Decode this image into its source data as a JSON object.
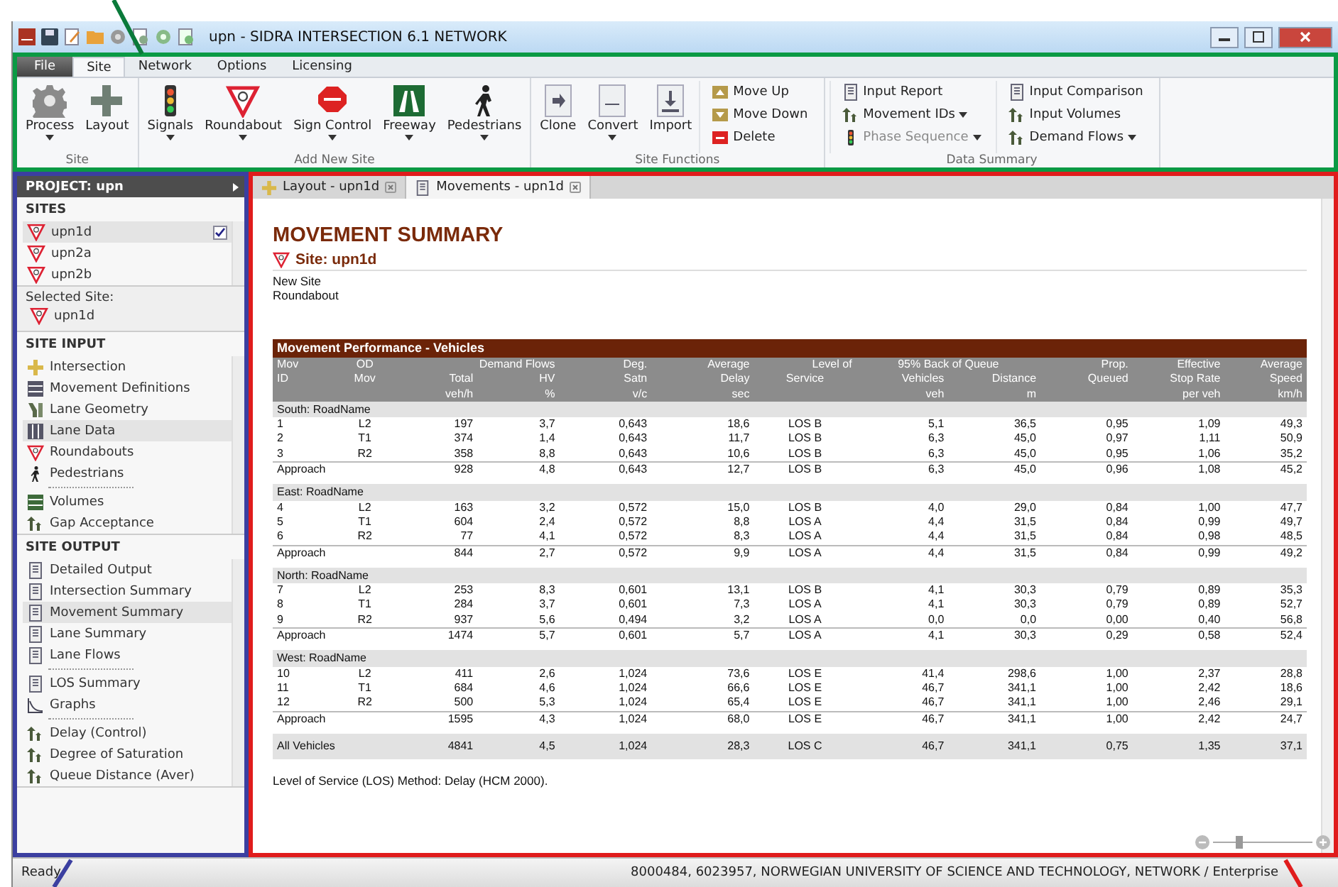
{
  "window": {
    "title": "upn - SIDRA INTERSECTION 6.1 NETWORK"
  },
  "ribbon": {
    "tabs": [
      {
        "label": "File",
        "selected": false,
        "kind": "file"
      },
      {
        "label": "Site",
        "selected": true,
        "kind": "tab"
      },
      {
        "label": "Network",
        "selected": false,
        "kind": "tab"
      },
      {
        "label": "Options",
        "selected": false,
        "kind": "tab"
      },
      {
        "label": "Licensing",
        "selected": false,
        "kind": "tab"
      }
    ],
    "groups": [
      {
        "label": "Site",
        "large": [
          {
            "label": "Process",
            "dropdown": true
          },
          {
            "label": "Layout",
            "dropdown": false
          }
        ]
      },
      {
        "label": "Add New Site",
        "large": [
          {
            "label": "Signals",
            "dropdown": true
          },
          {
            "label": "Roundabout",
            "dropdown": true
          },
          {
            "label": "Sign Control",
            "dropdown": true
          },
          {
            "label": "Freeway",
            "dropdown": true
          },
          {
            "label": "Pedestrians",
            "dropdown": true
          }
        ]
      },
      {
        "label": "Site Functions",
        "large": [
          {
            "label": "Clone",
            "dropdown": false
          },
          {
            "label": "Convert",
            "dropdown": true
          },
          {
            "label": "Import",
            "dropdown": false
          }
        ],
        "small": [
          [
            {
              "label": "Move Up",
              "dropdown": false,
              "disabled": false
            },
            {
              "label": "Move Down",
              "dropdown": false,
              "disabled": false
            },
            {
              "label": "Delete",
              "dropdown": false,
              "disabled": false
            }
          ]
        ]
      },
      {
        "label": "Data Summary",
        "small": [
          [
            {
              "label": "Input Report",
              "dropdown": false,
              "disabled": false
            },
            {
              "label": "Movement IDs",
              "dropdown": true,
              "disabled": false
            },
            {
              "label": "Phase Sequence",
              "dropdown": true,
              "disabled": true
            }
          ],
          [
            {
              "label": "Input Comparison",
              "dropdown": false,
              "disabled": false
            },
            {
              "label": "Input Volumes",
              "dropdown": false,
              "disabled": false
            },
            {
              "label": "Demand Flows",
              "dropdown": true,
              "disabled": false
            }
          ]
        ]
      }
    ]
  },
  "sidebar": {
    "project": "PROJECT:  upn",
    "sites": {
      "title": "SITES",
      "items": [
        {
          "name": "upn1d",
          "selected": true,
          "checked": true
        },
        {
          "name": "upn2a",
          "selected": false,
          "checked": false
        },
        {
          "name": "upn2b",
          "selected": false,
          "checked": false
        }
      ]
    },
    "selected_site": {
      "label": "Selected Site:",
      "name": "upn1d"
    },
    "input": {
      "title": "SITE INPUT",
      "groups": [
        [
          {
            "label": "Intersection",
            "selected": false
          },
          {
            "label": "Movement Definitions",
            "selected": false
          },
          {
            "label": "Lane Geometry",
            "selected": false
          },
          {
            "label": "Lane Data",
            "selected": true
          },
          {
            "label": "Roundabouts",
            "selected": false
          },
          {
            "label": "Pedestrians",
            "selected": false
          }
        ],
        [
          {
            "label": "Volumes",
            "selected": false
          },
          {
            "label": "Gap Acceptance",
            "selected": false
          }
        ]
      ]
    },
    "output": {
      "title": "SITE OUTPUT",
      "groups": [
        [
          {
            "label": "Detailed Output",
            "selected": false
          },
          {
            "label": "Intersection Summary",
            "selected": false
          },
          {
            "label": "Movement Summary",
            "selected": true
          },
          {
            "label": "Lane Summary",
            "selected": false
          },
          {
            "label": "Lane Flows",
            "selected": false
          }
        ],
        [
          {
            "label": "LOS Summary",
            "selected": false
          },
          {
            "label": "Graphs",
            "selected": false
          }
        ],
        [
          {
            "label": "Delay (Control)",
            "selected": false
          },
          {
            "label": "Degree of Saturation",
            "selected": false
          },
          {
            "label": "Queue Distance (Aver)",
            "selected": false
          }
        ]
      ]
    }
  },
  "document_tabs": [
    {
      "label": "Layout - upn1d",
      "selected": false
    },
    {
      "label": "Movements - upn1d",
      "selected": true
    }
  ],
  "report": {
    "title": "MOVEMENT SUMMARY",
    "site": "Site: upn1d",
    "lines": [
      "New Site",
      "Roundabout"
    ],
    "table": {
      "caption": "Movement Performance - Vehicles",
      "header_rows": [
        [
          {
            "text": "Mov"
          },
          {
            "text": "OD"
          },
          {
            "text": "Demand Flows",
            "kind": "group"
          },
          {
            "text": "Deg."
          },
          {
            "text": "Average"
          },
          {
            "text": "Level of"
          },
          {
            "text": "95% Back of Queue",
            "kind": "group"
          },
          {
            "text": "Prop."
          },
          {
            "text": "Effective"
          },
          {
            "text": "Average"
          }
        ],
        [
          {
            "text": "ID"
          },
          {
            "text": "Mov"
          },
          {
            "text": "Total"
          },
          {
            "text": "HV"
          },
          {
            "text": "Satn"
          },
          {
            "text": "Delay"
          },
          {
            "text": "Service"
          },
          {
            "text": "Vehicles"
          },
          {
            "text": "Distance"
          },
          {
            "text": "Queued"
          },
          {
            "text": "Stop Rate"
          },
          {
            "text": "Speed"
          }
        ],
        [
          null,
          null,
          {
            "text": "veh/h"
          },
          {
            "text": "%"
          },
          {
            "text": "v/c"
          },
          {
            "text": "sec"
          },
          null,
          {
            "text": "veh"
          },
          {
            "text": "m"
          },
          null,
          {
            "text": "per veh"
          },
          {
            "text": "km/h"
          }
        ]
      ],
      "sections": [
        {
          "title": "South: RoadName",
          "rows": [
            [
              "1",
              "L2",
              "197",
              "3,7",
              "0,643",
              "18,6",
              "LOS B",
              "5,1",
              "36,5",
              "0,95",
              "1,09",
              "49,3"
            ],
            [
              "2",
              "T1",
              "374",
              "1,4",
              "0,643",
              "11,7",
              "LOS B",
              "6,3",
              "45,0",
              "0,97",
              "1,11",
              "50,9"
            ],
            [
              "3",
              "R2",
              "358",
              "8,8",
              "0,643",
              "10,6",
              "LOS B",
              "6,3",
              "45,0",
              "0,95",
              "1,06",
              "35,2"
            ]
          ],
          "approach": {
            "label": "Approach",
            "values": [
              "928",
              "4,8",
              "0,643",
              "12,7",
              "LOS B",
              "6,3",
              "45,0",
              "0,96",
              "1,08",
              "45,2"
            ]
          }
        },
        {
          "title": "East: RoadName",
          "rows": [
            [
              "4",
              "L2",
              "163",
              "3,2",
              "0,572",
              "15,0",
              "LOS B",
              "4,0",
              "29,0",
              "0,84",
              "1,00",
              "47,7"
            ],
            [
              "5",
              "T1",
              "604",
              "2,4",
              "0,572",
              "8,8",
              "LOS A",
              "4,4",
              "31,5",
              "0,84",
              "0,99",
              "49,7"
            ],
            [
              "6",
              "R2",
              "77",
              "4,1",
              "0,572",
              "8,3",
              "LOS A",
              "4,4",
              "31,5",
              "0,84",
              "0,98",
              "48,5"
            ]
          ],
          "approach": {
            "label": "Approach",
            "values": [
              "844",
              "2,7",
              "0,572",
              "9,9",
              "LOS A",
              "4,4",
              "31,5",
              "0,84",
              "0,99",
              "49,2"
            ]
          }
        },
        {
          "title": "North: RoadName",
          "rows": [
            [
              "7",
              "L2",
              "253",
              "8,3",
              "0,601",
              "13,1",
              "LOS B",
              "4,1",
              "30,3",
              "0,79",
              "0,89",
              "35,3"
            ],
            [
              "8",
              "T1",
              "284",
              "3,7",
              "0,601",
              "7,3",
              "LOS A",
              "4,1",
              "30,3",
              "0,79",
              "0,89",
              "52,7"
            ],
            [
              "9",
              "R2",
              "937",
              "5,6",
              "0,494",
              "3,2",
              "LOS A",
              "0,0",
              "0,0",
              "0,00",
              "0,40",
              "56,8"
            ]
          ],
          "approach": {
            "label": "Approach",
            "values": [
              "1474",
              "5,7",
              "0,601",
              "5,7",
              "LOS A",
              "4,1",
              "30,3",
              "0,29",
              "0,58",
              "52,4"
            ]
          }
        },
        {
          "title": "West: RoadName",
          "rows": [
            [
              "10",
              "L2",
              "411",
              "2,6",
              "1,024",
              "73,6",
              "LOS E",
              "41,4",
              "298,6",
              "1,00",
              "2,37",
              "28,8"
            ],
            [
              "11",
              "T1",
              "684",
              "4,6",
              "1,024",
              "66,6",
              "LOS E",
              "46,7",
              "341,1",
              "1,00",
              "2,42",
              "18,6"
            ],
            [
              "12",
              "R2",
              "500",
              "5,3",
              "1,024",
              "65,4",
              "LOS E",
              "46,7",
              "341,1",
              "1,00",
              "2,46",
              "29,1"
            ]
          ],
          "approach": {
            "label": "Approach",
            "values": [
              "1595",
              "4,3",
              "1,024",
              "68,0",
              "LOS E",
              "46,7",
              "341,1",
              "1,00",
              "2,42",
              "24,7"
            ]
          }
        }
      ],
      "total": {
        "label": "All Vehicles",
        "values": [
          "4841",
          "4,5",
          "1,024",
          "28,3",
          "LOS C",
          "46,7",
          "341,1",
          "0,75",
          "1,35",
          "37,1"
        ]
      }
    },
    "notes": [
      "Level of Service (LOS) Method: Delay (HCM 2000)."
    ],
    "zoom": {
      "level": 0.25
    }
  },
  "status_bar": {
    "state": "Ready",
    "info": "8000484, 6023957, NORWEGIAN UNIVERSITY OF SCIENCE AND TECHNOLOGY, NETWORK / Enterprise"
  }
}
